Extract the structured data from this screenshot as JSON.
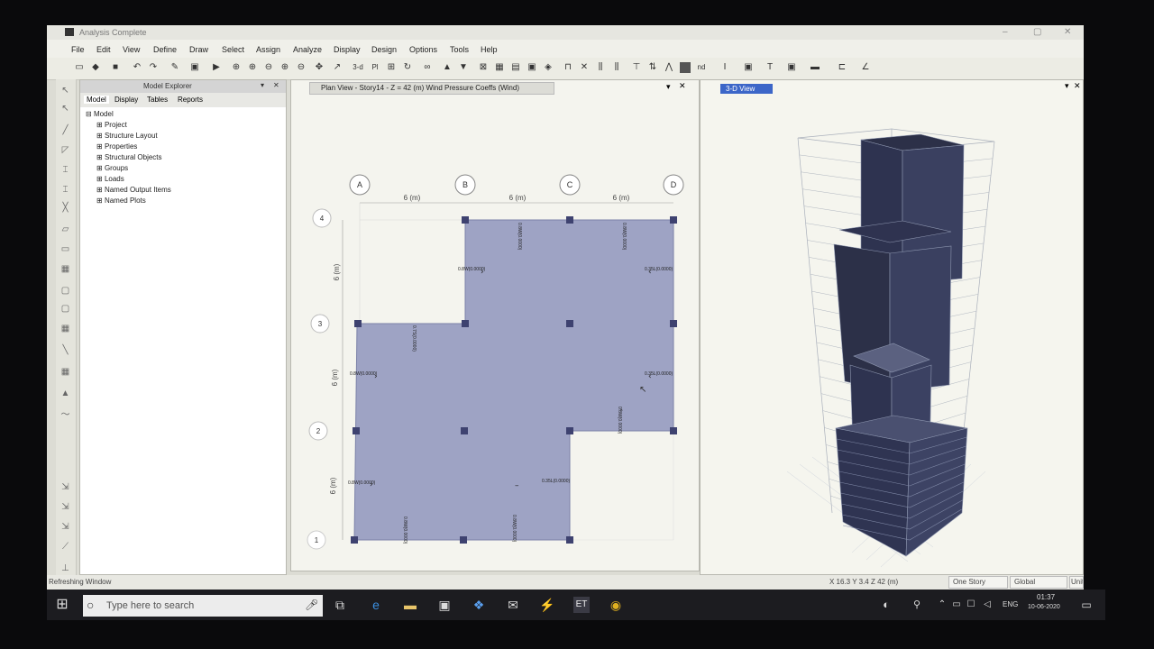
{
  "window": {
    "title": "Analysis Complete"
  },
  "menu": [
    "File",
    "Edit",
    "View",
    "Define",
    "Draw",
    "Select",
    "Assign",
    "Analyze",
    "Display",
    "Design",
    "Options",
    "Tools",
    "Help"
  ],
  "toolbar": {
    "view_3d_label": "3-d",
    "plan_label": "Pl",
    "nd_label": "nd"
  },
  "explorer": {
    "title": "Model Explorer",
    "tabs": [
      "Model",
      "Display",
      "Tables",
      "Reports"
    ],
    "root": "Model",
    "items": [
      "Project",
      "Structure Layout",
      "Properties",
      "Structural Objects",
      "Groups",
      "Loads",
      "Named Output Items",
      "Named Plots"
    ]
  },
  "plan_view": {
    "tab_title": "Plan View - Story14 - Z = 42 (m)  Wind Pressure Coeffs (Wind)",
    "grid_x": [
      "A",
      "B",
      "C",
      "D"
    ],
    "grid_y": [
      "4",
      "3",
      "2",
      "1"
    ],
    "dims_x": [
      "6 (m)",
      "6 (m)",
      "6 (m)"
    ],
    "dims_y": [
      "6 (m)",
      "6 (m)",
      "6 (m)"
    ],
    "coef_labels": [
      "0.8W(0.0000)",
      "0.35L(0.0000)",
      "0.8W(0.0000)",
      "0.35L(0.0000)",
      "0.8W(0.0000)",
      "0.35L(0.0000)",
      "0.8W(0.0000)",
      "0.8W(0.0000)",
      "0.7S(0.0000)",
      "0.8W(0.0000)",
      "0.8W(0.0000)",
      "0.8W(0.0000)"
    ]
  },
  "view3d": {
    "tab_title": "3-D View"
  },
  "status": {
    "left": "Refreshing Window",
    "coords": "X 16.3  Y 3.4  Z 42 (m)",
    "story": "One Story",
    "system": "Global",
    "units": "Units"
  },
  "taskbar": {
    "search_placeholder": "Type here to search",
    "lang": "ENG",
    "time": "01:37",
    "date": "10-06-2020"
  }
}
